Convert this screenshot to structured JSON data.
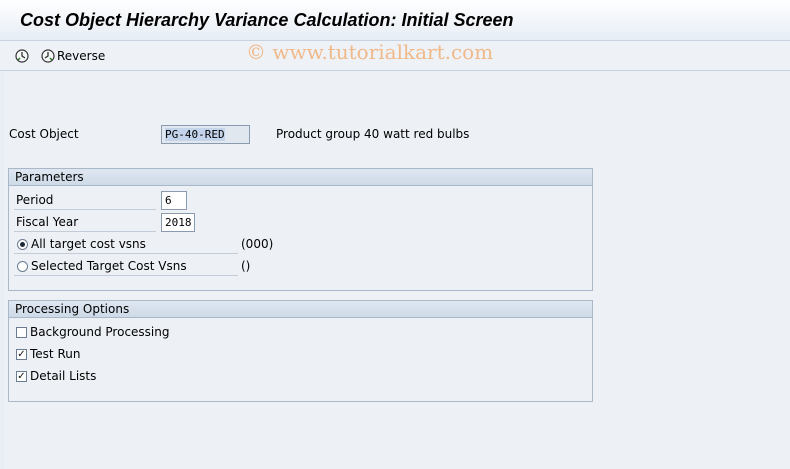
{
  "window": {
    "title": "Cost Object Hierarchy Variance Calculation: Initial Screen"
  },
  "toolbar": {
    "execute_icon": "execute-clock-icon",
    "reverse_icon": "reverse-clock-icon",
    "reverse_label": "Reverse"
  },
  "watermark": "© www.tutorialkart.com",
  "cost_object": {
    "label": "Cost Object",
    "value": "PG-40-RED",
    "description": "Product group 40 watt red bulbs"
  },
  "parameters": {
    "title": "Parameters",
    "period_label": "Period",
    "period_value": "6",
    "fiscal_year_label": "Fiscal Year",
    "fiscal_year_value": "2018",
    "all_target_label": "All target cost vsns",
    "all_target_value": "(000)",
    "all_target_selected": true,
    "selected_target_label": "Selected Target Cost Vsns",
    "selected_target_value": "()",
    "selected_target_selected": false
  },
  "processing": {
    "title": "Processing Options",
    "background_label": "Background Processing",
    "background_checked": false,
    "test_run_label": "Test Run",
    "test_run_checked": true,
    "detail_lists_label": "Detail Lists",
    "detail_lists_checked": true,
    "check_mark": "✓"
  }
}
